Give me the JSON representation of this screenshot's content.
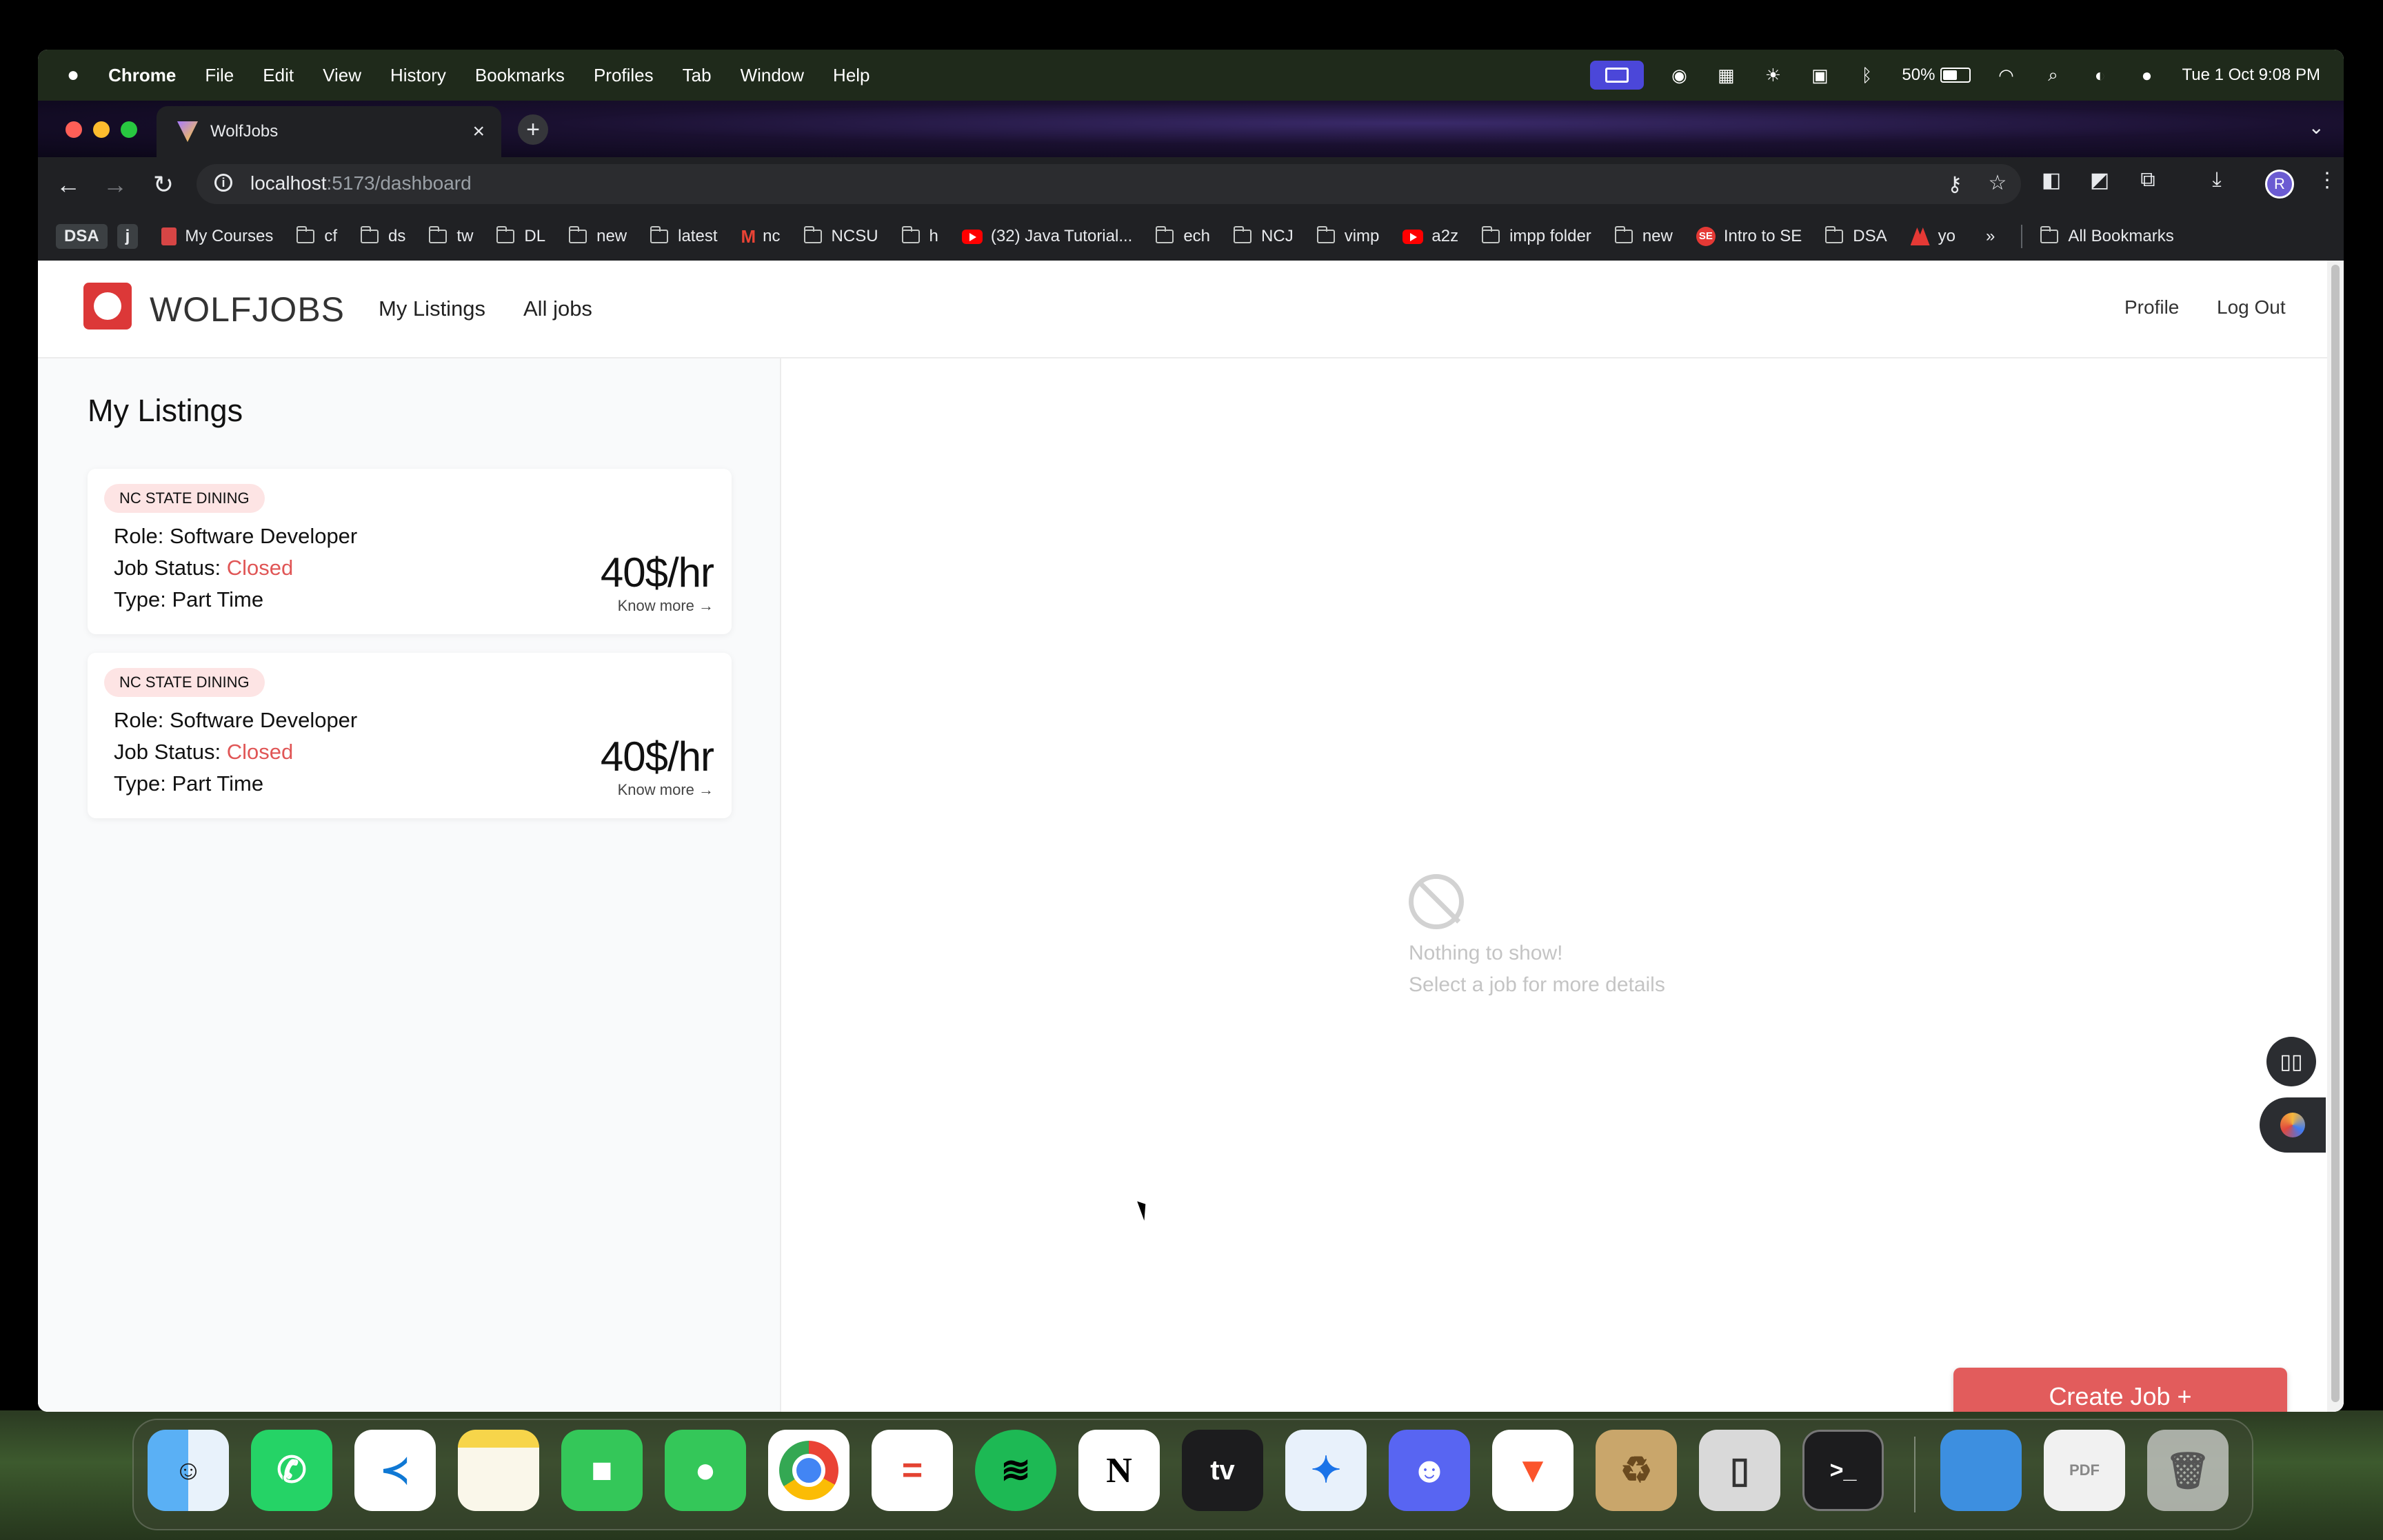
{
  "menubar": {
    "app": "Chrome",
    "items": [
      "File",
      "Edit",
      "View",
      "History",
      "Bookmarks",
      "Profiles",
      "Tab",
      "Window",
      "Help"
    ],
    "battery": "50%",
    "datetime": "Tue 1 Oct  9:08 PM"
  },
  "browser": {
    "tab_title": "WolfJobs",
    "url_host": "localhost",
    "url_path": ":5173/dashboard",
    "bookmarks": {
      "chip1": "DSA",
      "chip2": "j",
      "b1": "My Courses",
      "b2": "cf",
      "b3": "ds",
      "b4": "tw",
      "b5": "DL",
      "b6": "new",
      "b7": "latest",
      "b8": "nc",
      "b9": "NCSU",
      "b10": "h",
      "b11": "(32) Java Tutorial...",
      "b12": "ech",
      "b13": "NCJ",
      "b14": "vimp",
      "b15": "a2z",
      "b16": "impp folder",
      "b17": "new",
      "b18": "Intro to SE",
      "b19": "DSA",
      "b20": "yo",
      "more": "»",
      "all": "All Bookmarks"
    },
    "avatar_letter": "R"
  },
  "app": {
    "brand": "WOLFJOBS",
    "nav": {
      "my_listings": "My Listings",
      "all_jobs": "All jobs",
      "profile": "Profile",
      "logout": "Log Out"
    },
    "left_title": "My Listings",
    "listings": [
      {
        "company": "NC STATE DINING",
        "role_label": "Role:",
        "role": "Software Developer",
        "status_label": "Job Status:",
        "status": "Closed",
        "type_label": "Type:",
        "type": "Part Time",
        "pay": "40$/hr",
        "more": "Know more →"
      },
      {
        "company": "NC STATE DINING",
        "role_label": "Role:",
        "role": "Software Developer",
        "status_label": "Job Status:",
        "status": "Closed",
        "type_label": "Type:",
        "type": "Part Time",
        "pay": "40$/hr",
        "more": "Know more →"
      }
    ],
    "empty_title": "Nothing to show!",
    "empty_sub": "Select a job for more details",
    "create_button": "Create Job +"
  },
  "dock": {
    "apps": [
      "finder-icon",
      "whatsapp-icon",
      "vscode-icon",
      "notes-icon",
      "facetime-icon",
      "messages-icon",
      "chrome-icon",
      "todoist-icon",
      "spotify-icon",
      "notion-icon",
      "appletv-icon",
      "safari-icon",
      "discord-icon",
      "brave-icon",
      "archive-utility-icon",
      "iphone-mirroring-icon",
      "terminal-icon",
      "folder-icon",
      "pdf-file-icon",
      "trash-icon"
    ],
    "notion_letter": "N",
    "tv_label": "tv"
  },
  "colors": {
    "accent": "#e25c5c",
    "status_closed": "#e05656",
    "badge_bg": "#fde4e4"
  }
}
